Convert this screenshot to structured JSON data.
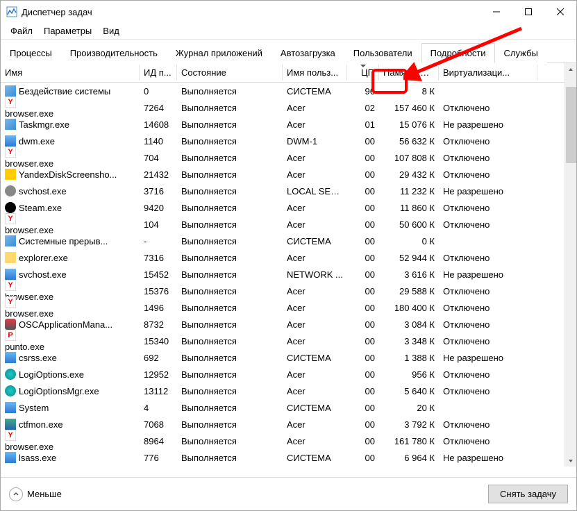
{
  "titlebar": {
    "title": "Диспетчер задач"
  },
  "menu": {
    "file": "Файл",
    "options": "Параметры",
    "view": "Вид"
  },
  "tabs": {
    "processes": "Процессы",
    "performance": "Производительность",
    "app_history": "Журнал приложений",
    "startup": "Автозагрузка",
    "users": "Пользователи",
    "details": "Подробности",
    "services": "Службы"
  },
  "columns": {
    "name": "Имя",
    "id": "ИД п...",
    "state": "Состояние",
    "user": "Имя польз...",
    "cpu": "ЦП",
    "memory": "Память (ак...",
    "virt": "Виртуализаци..."
  },
  "rows": [
    {
      "icon": "app",
      "name": "Бездействие системы",
      "id": "0",
      "state": "Выполняется",
      "user": "СИСТЕМА",
      "cpu": "96",
      "mem": "8 К",
      "virt": ""
    },
    {
      "icon": "y",
      "name": "browser.exe",
      "id": "7264",
      "state": "Выполняется",
      "user": "Acer",
      "cpu": "02",
      "mem": "157 460 К",
      "virt": "Отключено"
    },
    {
      "icon": "tm",
      "name": "Taskmgr.exe",
      "id": "14608",
      "state": "Выполняется",
      "user": "Acer",
      "cpu": "01",
      "mem": "15 076 К",
      "virt": "Не разрешено"
    },
    {
      "icon": "win",
      "name": "dwm.exe",
      "id": "1140",
      "state": "Выполняется",
      "user": "DWM-1",
      "cpu": "00",
      "mem": "56 632 К",
      "virt": "Отключено"
    },
    {
      "icon": "y",
      "name": "browser.exe",
      "id": "704",
      "state": "Выполняется",
      "user": "Acer",
      "cpu": "00",
      "mem": "107 808 К",
      "virt": "Отключено"
    },
    {
      "icon": "yd",
      "name": "YandexDiskScreensho...",
      "id": "21432",
      "state": "Выполняется",
      "user": "Acer",
      "cpu": "00",
      "mem": "29 432 К",
      "virt": "Отключено"
    },
    {
      "icon": "gear",
      "name": "svchost.exe",
      "id": "3716",
      "state": "Выполняется",
      "user": "LOCAL SER...",
      "cpu": "00",
      "mem": "11 232 К",
      "virt": "Не разрешено"
    },
    {
      "icon": "steam",
      "name": "Steam.exe",
      "id": "9420",
      "state": "Выполняется",
      "user": "Acer",
      "cpu": "00",
      "mem": "11 860 К",
      "virt": "Отключено"
    },
    {
      "icon": "y",
      "name": "browser.exe",
      "id": "104",
      "state": "Выполняется",
      "user": "Acer",
      "cpu": "00",
      "mem": "50 600 К",
      "virt": "Отключено"
    },
    {
      "icon": "app",
      "name": "Системные прерыв...",
      "id": "-",
      "state": "Выполняется",
      "user": "СИСТЕМА",
      "cpu": "00",
      "mem": "0 К",
      "virt": ""
    },
    {
      "icon": "folder",
      "name": "explorer.exe",
      "id": "7316",
      "state": "Выполняется",
      "user": "Acer",
      "cpu": "00",
      "mem": "52 944 К",
      "virt": "Отключено"
    },
    {
      "icon": "win",
      "name": "svchost.exe",
      "id": "15452",
      "state": "Выполняется",
      "user": "NETWORK ...",
      "cpu": "00",
      "mem": "3 616 К",
      "virt": "Не разрешено"
    },
    {
      "icon": "y",
      "name": "browser.exe",
      "id": "15376",
      "state": "Выполняется",
      "user": "Acer",
      "cpu": "00",
      "mem": "29 588 К",
      "virt": "Отключено"
    },
    {
      "icon": "y",
      "name": "browser.exe",
      "id": "1496",
      "state": "Выполняется",
      "user": "Acer",
      "cpu": "00",
      "mem": "180 400 К",
      "virt": "Отключено"
    },
    {
      "icon": "osc",
      "name": "OSCApplicationMana...",
      "id": "8732",
      "state": "Выполняется",
      "user": "Acer",
      "cpu": "00",
      "mem": "3 084 К",
      "virt": "Отключено"
    },
    {
      "icon": "p",
      "name": "punto.exe",
      "id": "15340",
      "state": "Выполняется",
      "user": "Acer",
      "cpu": "00",
      "mem": "3 348 К",
      "virt": "Отключено"
    },
    {
      "icon": "win",
      "name": "csrss.exe",
      "id": "692",
      "state": "Выполняется",
      "user": "СИСТЕМА",
      "cpu": "00",
      "mem": "1 388 К",
      "virt": "Не разрешено"
    },
    {
      "icon": "logi",
      "name": "LogiOptions.exe",
      "id": "12952",
      "state": "Выполняется",
      "user": "Acer",
      "cpu": "00",
      "mem": "956 К",
      "virt": "Отключено"
    },
    {
      "icon": "logi",
      "name": "LogiOptionsMgr.exe",
      "id": "13112",
      "state": "Выполняется",
      "user": "Acer",
      "cpu": "00",
      "mem": "5 640 К",
      "virt": "Отключено"
    },
    {
      "icon": "win",
      "name": "System",
      "id": "4",
      "state": "Выполняется",
      "user": "СИСТЕМА",
      "cpu": "00",
      "mem": "20 К",
      "virt": ""
    },
    {
      "icon": "ctf",
      "name": "ctfmon.exe",
      "id": "7068",
      "state": "Выполняется",
      "user": "Acer",
      "cpu": "00",
      "mem": "3 792 К",
      "virt": "Отключено"
    },
    {
      "icon": "y",
      "name": "browser.exe",
      "id": "8964",
      "state": "Выполняется",
      "user": "Acer",
      "cpu": "00",
      "mem": "161 780 К",
      "virt": "Отключено"
    },
    {
      "icon": "win",
      "name": "lsass.exe",
      "id": "776",
      "state": "Выполняется",
      "user": "СИСТЕМА",
      "cpu": "00",
      "mem": "6 964 К",
      "virt": "Не разрешено"
    }
  ],
  "footer": {
    "fewer": "Меньше",
    "end_task": "Снять задачу"
  },
  "annotation": {
    "highlight_column": "cpu"
  }
}
